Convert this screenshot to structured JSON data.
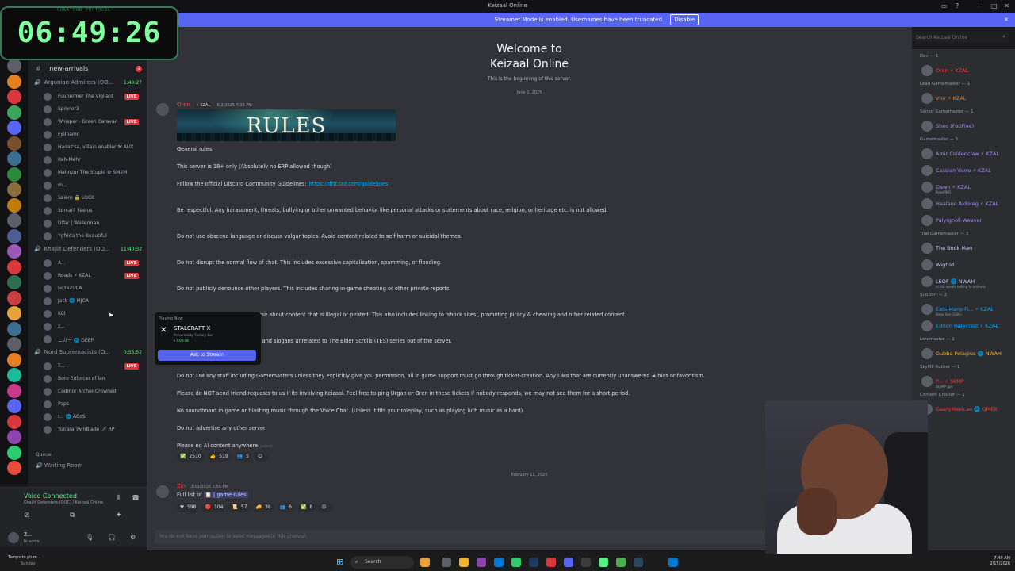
{
  "window": {
    "title": "Keizaal Online",
    "controls": [
      "▭",
      "?",
      "–",
      "□",
      "✕"
    ]
  },
  "banner": {
    "text": "Streamer Mode is enabled. Usernames have been truncated.",
    "button": "Disable",
    "close": "✕"
  },
  "timer": {
    "label": "SUBATHON PROTOCOL",
    "value": "06:49:26"
  },
  "search": {
    "placeholder": "Search Keizaal Online",
    "icon": "⌕"
  },
  "toolbar_icons": "⌁  ⚡  📌  👥",
  "server_colors": [
    "#5a5f68",
    "#e67e22",
    "#da373c",
    "#3ba55d",
    "#5865f2",
    "#7a4f2c",
    "#3b6e8f",
    "#2b8a3e",
    "#8a6d3b",
    "#c27c0e",
    "#5a5f68",
    "#4e5d94",
    "#9b59b6",
    "#da373c",
    "#2f6f4f",
    "#c93f3f",
    "#e6a23c",
    "#3b6e8f",
    "#5a5f68",
    "#e67e22",
    "#1abc9c",
    "#c73b8a",
    "#5865f2",
    "#da373c",
    "#8e44ad",
    "#2ecc71",
    "#e74c3c"
  ],
  "channel_header": {
    "hash": "#",
    "name": "new-arrivals",
    "badge": "1"
  },
  "voice_groups": [
    {
      "name": "Argonian Admirers (OO...",
      "time": "1:40:27",
      "users": [
        {
          "name": "Fuunermer The Vigilant",
          "live": "LIVE"
        },
        {
          "name": "Spinner3",
          "live": ""
        },
        {
          "name": "Whisper - Green Caravan",
          "live": "LIVE"
        },
        {
          "name": "Fjölhamr",
          "live": ""
        },
        {
          "name": "Hadaz'sa, villain enabler ⚒ AUX",
          "live": ""
        },
        {
          "name": "Kah-Mehr",
          "live": ""
        },
        {
          "name": "Mahnzur The Stupid ⚙ SM2M",
          "live": ""
        },
        {
          "name": "m...",
          "live": ""
        },
        {
          "name": "Saiem 🔒 LOCK",
          "live": ""
        },
        {
          "name": "Sorcarll Faelus",
          "live": ""
        },
        {
          "name": "Ulfar | Wellerman",
          "live": ""
        },
        {
          "name": "Ygfrida the Beautiful",
          "live": ""
        }
      ]
    },
    {
      "name": "Khajiit Defenders (OO...",
      "time": "11:40:32",
      "users": [
        {
          "name": "A...",
          "live": "LIVE"
        },
        {
          "name": "Roads ⚡ KZAL",
          "live": "LIVE"
        },
        {
          "name": "I<3aZULA",
          "live": ""
        },
        {
          "name": "Jack 🌐 MJGA",
          "live": ""
        },
        {
          "name": "KCI",
          "live": ""
        },
        {
          "name": "z...",
          "live": ""
        },
        {
          "name": "ニガー 🌐 DEEP",
          "live": ""
        }
      ]
    },
    {
      "name": "Nord Supremacists (O...",
      "time": "0:53:52",
      "users": [
        {
          "name": "T...",
          "live": "LIVE"
        },
        {
          "name": "Boro Enforcer of lan",
          "live": ""
        },
        {
          "name": "Codmor Archer-Crowned",
          "live": ""
        },
        {
          "name": "Paps",
          "live": ""
        },
        {
          "name": "r... 🌐 ACoS",
          "live": ""
        },
        {
          "name": "Yunara TwinBlade 🗡 RP",
          "live": ""
        }
      ]
    }
  ],
  "queue": {
    "label": "Queue",
    "channel": "Waiting Room"
  },
  "voice_panel": {
    "status": "Voice Connected",
    "sub": "Khajiit Defenders (OOC) / Keizaal Online",
    "username": "Z...",
    "userstatus": "In voice"
  },
  "welcome": {
    "line1": "Welcome to",
    "line2": "Keizaal Online",
    "line3": "This is the beginning of this server."
  },
  "date1": "June 2, 2025",
  "msg1": {
    "author": "Oren",
    "tag": "⚡ KZAL",
    "time": "6/2/2025 7:33 PM",
    "image_title": "RULES",
    "lines": [
      "General rules",
      "This server is 18+ only (Absolutely no ERP allowed though)",
      "Follow the official Discord Community Guidelines:",
      "Be respectful. Any harassment, threats, bullying or other unwanted behavior like personal attacks or statements about race, religion, or heritage etc. is not allowed.",
      "Do not use obscene language or discuss vulgar topics. Avoid content related to self-harm or suicidal themes.",
      "Do not disrupt the normal flow of chat. This includes excessive capitalization, spamming, or flooding.",
      "Do not publicly denounce other players. This includes sharing in-game cheating or other private reports.",
      "verse about content that is illegal or pirated. This also includes linking to 'shock sites', promoting piracy & cheating and other related content.",
      "bols and slogans unrelated to The Elder Scrolls (TES) series out of the server.",
      "rules.",
      "Do not DM any staff including Gamemasters unless they explicitly give you permission, all in game support must go through ticket-creation. Any DMs that are currently unanswered ≠ bias or favoritism.",
      "Please do NOT send friend requests to us if its involving Keizaal. Feel free to ping Urgan or Oren in these tickets if nobody responds, we may not see them for a short period.",
      "No soundboard in-game or blasting music through the Voice Chat. (Unless it fits your roleplay, such as playing luth music as a bard)",
      "Do not advertise any other server",
      "Please no AI content anywhere"
    ],
    "link": "https://discord.com/guidelines",
    "edited": "(edited)",
    "reactions": [
      {
        "e": "✅",
        "c": "2510"
      },
      {
        "e": "👍",
        "c": "519"
      },
      {
        "e": "👥",
        "c": "5"
      },
      {
        "e": "☺",
        "c": ""
      }
    ]
  },
  "date2": "February 11, 2026",
  "msg2": {
    "author": "Zin",
    "time": "2/11/2026 1:56 PM",
    "text": "Full list of",
    "channel": "📋 | game-rules",
    "reactions": [
      {
        "e": "❤",
        "c": "598"
      },
      {
        "e": "🔴",
        "c": "104"
      },
      {
        "e": "📜",
        "c": "57"
      },
      {
        "e": "🧀",
        "c": "38"
      },
      {
        "e": "👥",
        "c": "6"
      },
      {
        "e": "✅",
        "c": "8"
      },
      {
        "e": "☺",
        "c": ""
      }
    ]
  },
  "popup": {
    "label": "Playing Now",
    "game": "STALCRAFT X",
    "sub": "Pervomaisky Factory Bar",
    "time": "⏵ 7:02:48",
    "button": "Ask to Stream"
  },
  "composer": {
    "placeholder": "You do not have permission to send messages in this channel."
  },
  "members": [
    {
      "type": "head",
      "text": "Dev — 1"
    },
    {
      "type": "m",
      "name": "Oren ⚡ KZAL",
      "color": "#f23f42",
      "sub": ""
    },
    {
      "type": "head",
      "text": "Lead Gamemaster — 1"
    },
    {
      "type": "m",
      "name": "Vlor ⚡ KZAL",
      "color": "#e67e22",
      "sub": ""
    },
    {
      "type": "head",
      "text": "Senior Gamemaster — 1"
    },
    {
      "type": "m",
      "name": "Sheo (FotiFive)",
      "color": "#b084f5",
      "sub": ""
    },
    {
      "type": "head",
      "text": "Gamemaster — 5"
    },
    {
      "type": "m",
      "name": "Amir Coldenclaw ⚡ KZAL",
      "color": "#a58af0",
      "sub": ""
    },
    {
      "type": "m",
      "name": "Cassian Varro ⚡ KZAL",
      "color": "#a58af0",
      "sub": ""
    },
    {
      "type": "m",
      "name": "Dawn ⚡ KZAL",
      "color": "#a58af0",
      "sub": "PokeMMO"
    },
    {
      "type": "m",
      "name": "Haalano Aldoreg ⚡ KZAL",
      "color": "#a58af0",
      "sub": ""
    },
    {
      "type": "m",
      "name": "Palyrgnoll-Weaver",
      "color": "#a58af0",
      "sub": ""
    },
    {
      "type": "head",
      "text": "Trial Gamemaster — 3"
    },
    {
      "type": "m",
      "name": "The Book Man",
      "color": "#c9cdfb",
      "sub": ""
    },
    {
      "type": "m",
      "name": "Wigfrid",
      "color": "#c9cdfb",
      "sub": ""
    },
    {
      "type": "m",
      "name": "LEOF 🌐 NWAH",
      "color": "#c9cdfb",
      "sub": "in the woods talking to animals"
    },
    {
      "type": "head",
      "text": "Support — 2"
    },
    {
      "type": "m",
      "name": "Eats-Many-Fi... ⚡ KZAL",
      "color": "#00a8fc",
      "sub": "Deep Sea Chillin"
    },
    {
      "type": "m",
      "name": "Edrien Halecrest ⚡ KZAL",
      "color": "#00a8fc",
      "sub": ""
    },
    {
      "type": "head",
      "text": "Loremaster — 1"
    },
    {
      "type": "m",
      "name": "Gubba Pelagius 🌐 NWAH",
      "color": "#f0b232",
      "sub": ""
    },
    {
      "type": "head",
      "text": "SkyMP Author — 1"
    },
    {
      "type": "m",
      "name": "P... ⚡ SKMP",
      "color": "#f23f42",
      "sub": "SkyMP guy"
    },
    {
      "type": "head",
      "text": "Content Creator — 1"
    },
    {
      "type": "m",
      "name": "GaaryMexican 🌐 GMEX",
      "color": "#f23f42",
      "sub": ""
    }
  ],
  "taskbar": {
    "weather": "Temps to plum...",
    "weather2": "Sunday",
    "search": "Search",
    "time": "7:49 AM",
    "date": "2/15/2026"
  }
}
